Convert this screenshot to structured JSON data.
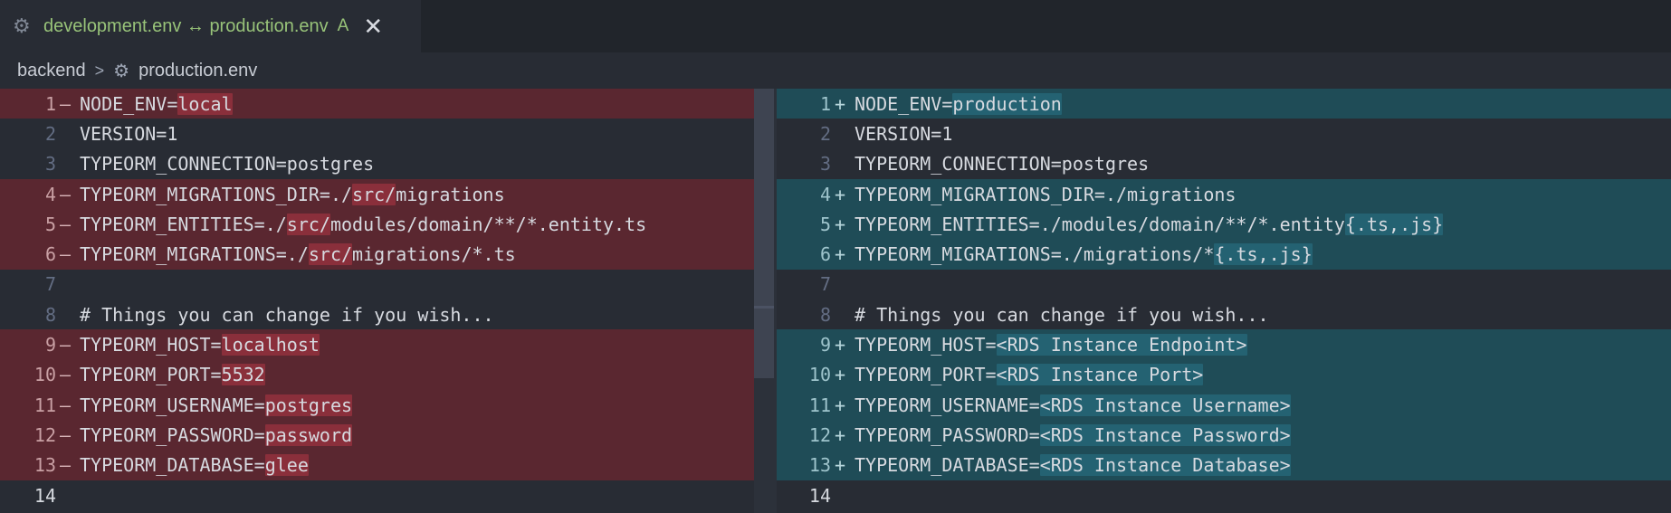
{
  "tab": {
    "title": "development.env ↔ production.env",
    "badge": "A",
    "icon": "gear-icon",
    "close_label": "✕"
  },
  "breadcrumb": {
    "folder": "backend",
    "separator": ">",
    "file": "production.env"
  },
  "left": {
    "lines": [
      {
        "num": "1",
        "marker": "—",
        "pre": "NODE_ENV=",
        "hl": "local",
        "post": "",
        "type": "del"
      },
      {
        "num": "2",
        "marker": "",
        "pre": "VERSION=1",
        "hl": "",
        "post": "",
        "type": ""
      },
      {
        "num": "3",
        "marker": "",
        "pre": "TYPEORM_CONNECTION=postgres",
        "hl": "",
        "post": "",
        "type": ""
      },
      {
        "num": "4",
        "marker": "—",
        "pre": "TYPEORM_MIGRATIONS_DIR=./",
        "hl": "src/",
        "post": "migrations",
        "type": "del"
      },
      {
        "num": "5",
        "marker": "—",
        "pre": "TYPEORM_ENTITIES=./",
        "hl": "src/",
        "post": "modules/domain/**/*.entity.ts",
        "type": "del"
      },
      {
        "num": "6",
        "marker": "—",
        "pre": "TYPEORM_MIGRATIONS=./",
        "hl": "src/",
        "post": "migrations/*.ts",
        "type": "del"
      },
      {
        "num": "7",
        "marker": "",
        "pre": "",
        "hl": "",
        "post": "",
        "type": ""
      },
      {
        "num": "8",
        "marker": "",
        "pre": "# Things you can change if you wish...",
        "hl": "",
        "post": "",
        "type": ""
      },
      {
        "num": "9",
        "marker": "—",
        "pre": "TYPEORM_HOST=",
        "hl": "localhost",
        "post": "",
        "type": "del"
      },
      {
        "num": "10",
        "marker": "—",
        "pre": "TYPEORM_PORT=",
        "hl": "5532",
        "post": "",
        "type": "del"
      },
      {
        "num": "11",
        "marker": "—",
        "pre": "TYPEORM_USERNAME=",
        "hl": "postgres",
        "post": "",
        "type": "del"
      },
      {
        "num": "12",
        "marker": "—",
        "pre": "TYPEORM_PASSWORD=",
        "hl": "password",
        "post": "",
        "type": "del"
      },
      {
        "num": "13",
        "marker": "—",
        "pre": "TYPEORM_DATABASE=",
        "hl": "glee",
        "post": "",
        "type": "del"
      },
      {
        "num": "14",
        "marker": "",
        "pre": "",
        "hl": "",
        "post": "",
        "type": "current"
      }
    ]
  },
  "right": {
    "lines": [
      {
        "num": "1",
        "marker": "+",
        "pre": "NODE_ENV=",
        "hl": "production",
        "post": "",
        "type": "add"
      },
      {
        "num": "2",
        "marker": "",
        "pre": "VERSION=1",
        "hl": "",
        "post": "",
        "type": ""
      },
      {
        "num": "3",
        "marker": "",
        "pre": "TYPEORM_CONNECTION=postgres",
        "hl": "",
        "post": "",
        "type": ""
      },
      {
        "num": "4",
        "marker": "+",
        "pre": "TYPEORM_MIGRATIONS_DIR=./migrations",
        "hl": "",
        "post": "",
        "type": "add"
      },
      {
        "num": "5",
        "marker": "+",
        "pre": "TYPEORM_ENTITIES=./modules/domain/**/*.entity",
        "hl": "{.ts,.js}",
        "post": "",
        "type": "add"
      },
      {
        "num": "6",
        "marker": "+",
        "pre": "TYPEORM_MIGRATIONS=./migrations/*",
        "hl": "{.ts,.js}",
        "post": "",
        "type": "add"
      },
      {
        "num": "7",
        "marker": "",
        "pre": "",
        "hl": "",
        "post": "",
        "type": ""
      },
      {
        "num": "8",
        "marker": "",
        "pre": "# Things you can change if you wish...",
        "hl": "",
        "post": "",
        "type": ""
      },
      {
        "num": "9",
        "marker": "+",
        "pre": "TYPEORM_HOST=",
        "hl": "<RDS Instance Endpoint>",
        "post": "",
        "type": "add"
      },
      {
        "num": "10",
        "marker": "+",
        "pre": "TYPEORM_PORT=",
        "hl": "<RDS Instance Port>",
        "post": "",
        "type": "add"
      },
      {
        "num": "11",
        "marker": "+",
        "pre": "TYPEORM_USERNAME=",
        "hl": "<RDS Instance Username>",
        "post": "",
        "type": "add"
      },
      {
        "num": "12",
        "marker": "+",
        "pre": "TYPEORM_PASSWORD=",
        "hl": "<RDS Instance Password>",
        "post": "",
        "type": "add"
      },
      {
        "num": "13",
        "marker": "+",
        "pre": "TYPEORM_DATABASE=",
        "hl": "<RDS Instance Database>",
        "post": "",
        "type": "add"
      },
      {
        "num": "14",
        "marker": "",
        "pre": "",
        "hl": "",
        "post": "",
        "type": "current"
      }
    ]
  }
}
